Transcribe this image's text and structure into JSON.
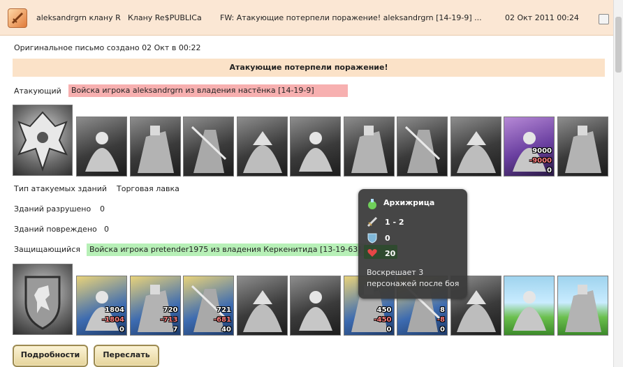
{
  "header": {
    "sender": "aleksandrgrn клану R",
    "recipient": "Клану Re$PUBLICa",
    "subject": "FW: Атакующие потерпели поражение! aleksandrgrn [14-19-9] ...",
    "date": "02 Окт 2011 00:24"
  },
  "letter": {
    "original_note": "Оригинальное письмо создано 02 Окт в 00:22",
    "banner": "Атакующие потерпели поражение!",
    "attacker_label": "Атакующий",
    "attacker_army": "Войска игрока aleksandrgrn из владения настёнка [14-19-9]",
    "building_type_label": "Тип атакуемых зданий",
    "building_type_value": "Торговая лавка",
    "destroyed_label": "Зданий разрушено",
    "destroyed_value": "0",
    "damaged_label": "Зданий повреждено",
    "damaged_value": "0",
    "defender_label": "Защищающийся",
    "defender_army": "Войска игрока pretender1975 из владения Керкенитида [13-19-63]"
  },
  "attacker_units": [
    {
      "name": "unit-1"
    },
    {
      "name": "unit-2"
    },
    {
      "name": "unit-3"
    },
    {
      "name": "unit-4"
    },
    {
      "name": "unit-5"
    },
    {
      "name": "unit-6"
    },
    {
      "name": "unit-7"
    },
    {
      "name": "unit-8"
    },
    {
      "name": "unit-9",
      "count": "9000",
      "loss": "-9000",
      "left": "0"
    },
    {
      "name": "unit-10"
    }
  ],
  "defender_units": [
    {
      "name": "unit-1",
      "count": "1804",
      "loss": "-1804",
      "left": "0"
    },
    {
      "name": "unit-2",
      "count": "720",
      "loss": "-713",
      "left": "7"
    },
    {
      "name": "unit-3",
      "count": "721",
      "loss": "-681",
      "left": "40"
    },
    {
      "name": "unit-4"
    },
    {
      "name": "unit-5"
    },
    {
      "name": "unit-6",
      "count": "450",
      "loss": "-450",
      "left": "0"
    },
    {
      "name": "unit-7",
      "count": "8",
      "loss": "-8",
      "left": "0"
    },
    {
      "name": "unit-8"
    },
    {
      "name": "unit-9"
    },
    {
      "name": "unit-10"
    }
  ],
  "tooltip": {
    "title": "Архижрица",
    "attack": "1 - 2",
    "defense": "0",
    "health": "20",
    "description": "Воскрешает 3 персонажей после боя"
  },
  "buttons": {
    "details": "Подробности",
    "forward": "Переслать"
  },
  "colors": {
    "header_bg": "#fbe7d4",
    "attacker_highlight": "#f7b0b0",
    "defender_highlight": "#b7f0b7",
    "loss_text": "#ff8080"
  }
}
